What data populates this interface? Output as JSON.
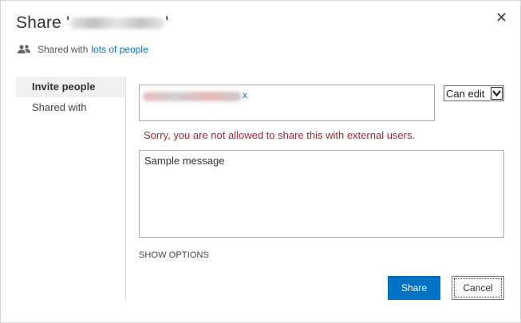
{
  "dialog": {
    "title_prefix": "Share '",
    "title_suffix": "'",
    "close_glyph": "✕"
  },
  "shared_summary": {
    "text": "Shared with",
    "link": "lots of people"
  },
  "sidebar": {
    "items": [
      {
        "label": "Invite people",
        "active": true
      },
      {
        "label": "Shared with",
        "active": false
      }
    ]
  },
  "invite": {
    "remove_glyph": "x",
    "permission": {
      "selected": "Can edit"
    },
    "error": "Sorry, you are not allowed to share this with external users."
  },
  "message": {
    "value": "Sample message"
  },
  "options": {
    "show_label": "SHOW OPTIONS"
  },
  "buttons": {
    "share": "Share",
    "cancel": "Cancel"
  },
  "colors": {
    "accent": "#0072c6",
    "error": "#a4262c"
  }
}
